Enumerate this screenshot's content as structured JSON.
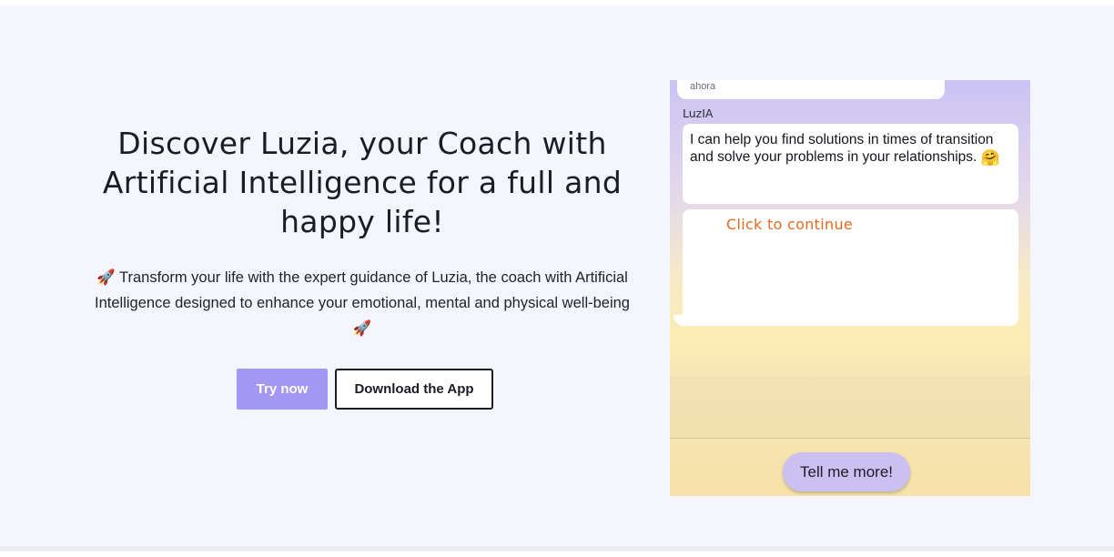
{
  "hero": {
    "title": "Discover Luzia, your Coach with Artificial Intelligence for a full and happy life!",
    "subtitle": "🚀 Transform your life with the expert guidance of Luzia, the coach with Artificial Intelligence designed to enhance your emotional, mental and physical well-being 🚀",
    "try_now_label": "Try now",
    "download_label": "Download the App"
  },
  "chat": {
    "previous_time": "ahora",
    "sender": "LuzIA",
    "message": "I can help you find solutions in times of transition and solve your problems in your relationships.",
    "message_emoji": "🤗",
    "continue_label": "Click to continue",
    "tell_more_label": "Tell me more!"
  },
  "colors": {
    "accent": "#a597f4",
    "continue_text": "#e56b1f",
    "tell_more_bg": "#cbc0f1",
    "page_bg": "#f5f5fd"
  }
}
